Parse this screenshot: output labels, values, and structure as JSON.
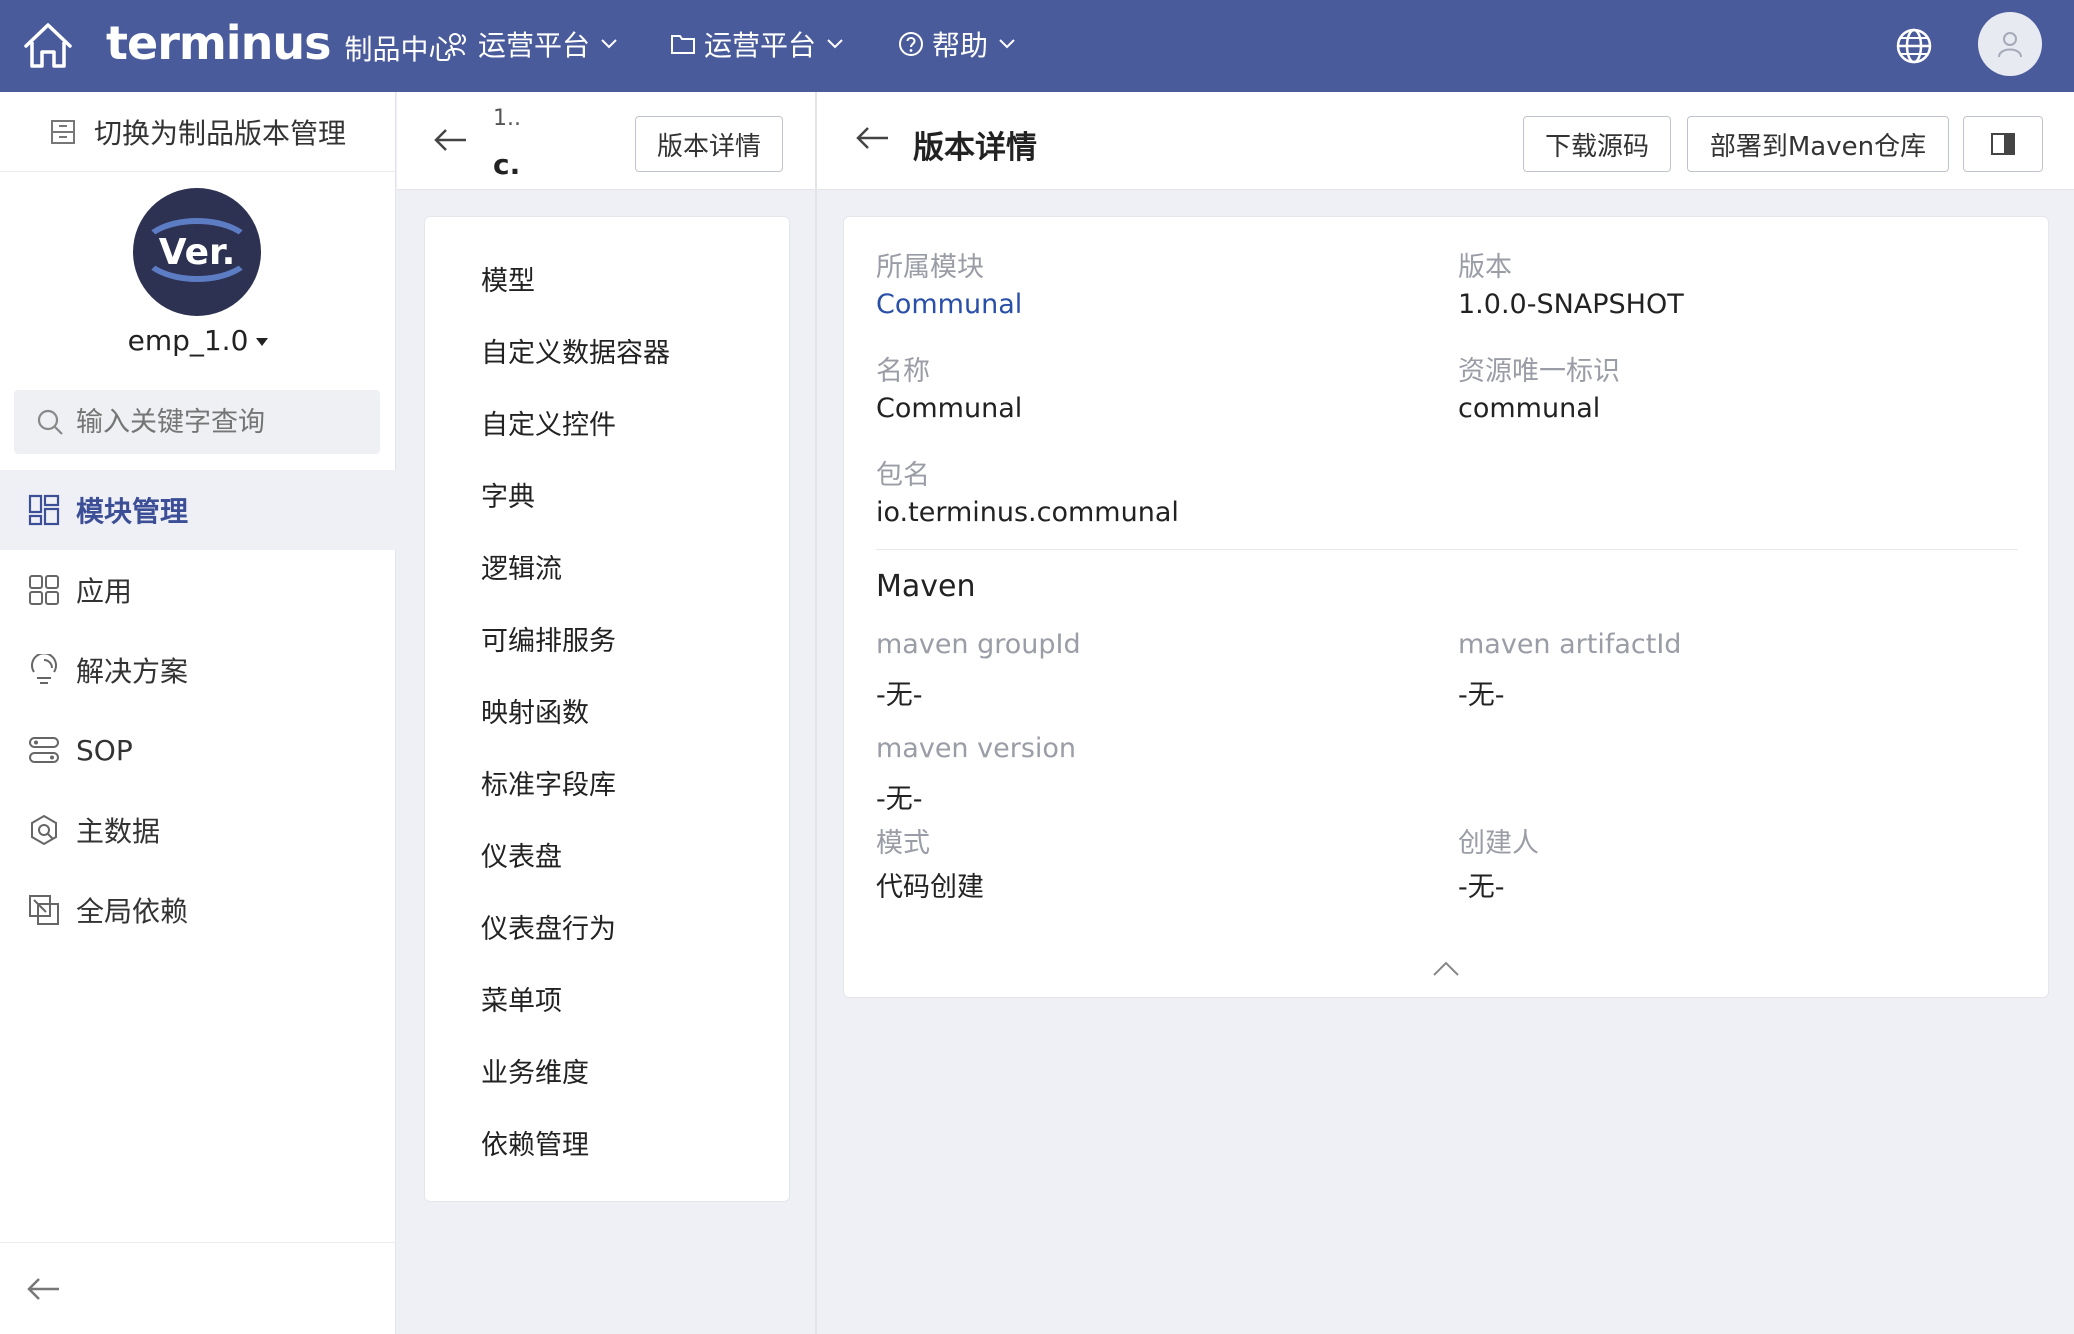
{
  "topbar": {
    "brand_logo": "terminus",
    "brand_sub": "制品中心",
    "nav": [
      {
        "label": "运营平台"
      },
      {
        "label": "运营平台"
      },
      {
        "label": "帮助"
      }
    ]
  },
  "sidebar": {
    "switch_label": "切换为制品版本管理",
    "avatar_text": "Ver.",
    "project_name": "emp_1.0",
    "search_placeholder": "输入关键字查询",
    "menu": [
      {
        "label": "模块管理",
        "icon": "module-icon",
        "active": true
      },
      {
        "label": "应用",
        "icon": "app-grid-icon"
      },
      {
        "label": "解决方案",
        "icon": "solution-icon"
      },
      {
        "label": "SOP",
        "icon": "sop-icon"
      },
      {
        "label": "主数据",
        "icon": "master-data-icon"
      },
      {
        "label": "全局依赖",
        "icon": "dependency-icon"
      }
    ]
  },
  "middle": {
    "crumb1": "1..",
    "crumb2": "c.",
    "button": "版本详情",
    "items": [
      "模型",
      "自定义数据容器",
      "自定义控件",
      "字典",
      "逻辑流",
      "可编排服务",
      "映射函数",
      "标准字段库",
      "仪表盘",
      "仪表盘行为",
      "菜单项",
      "业务维度",
      "依赖管理"
    ]
  },
  "right": {
    "title": "版本详情",
    "download_btn": "下载源码",
    "deploy_btn": "部署到Maven仓库",
    "fields": {
      "module_label": "所属模块",
      "module_value": "Communal",
      "version_label": "版本",
      "version_value": "1.0.0-SNAPSHOT",
      "name_label": "名称",
      "name_value": "Communal",
      "resource_label": "资源唯一标识",
      "resource_value": "communal",
      "package_label": "包名",
      "package_value": "io.terminus.communal"
    },
    "maven": {
      "title": "Maven",
      "group_label": "maven groupId",
      "group_value": "-无-",
      "artifact_label": "maven artifactId",
      "artifact_value": "-无-",
      "version_label": "maven version",
      "version_value": "-无-",
      "mode_label": "模式",
      "mode_value": "代码创建",
      "creator_label": "创建人",
      "creator_value": "-无-"
    }
  },
  "colors": {
    "topbar": "#4a5b9b",
    "active_text": "#3c4e95",
    "link": "#2a4fa8"
  }
}
